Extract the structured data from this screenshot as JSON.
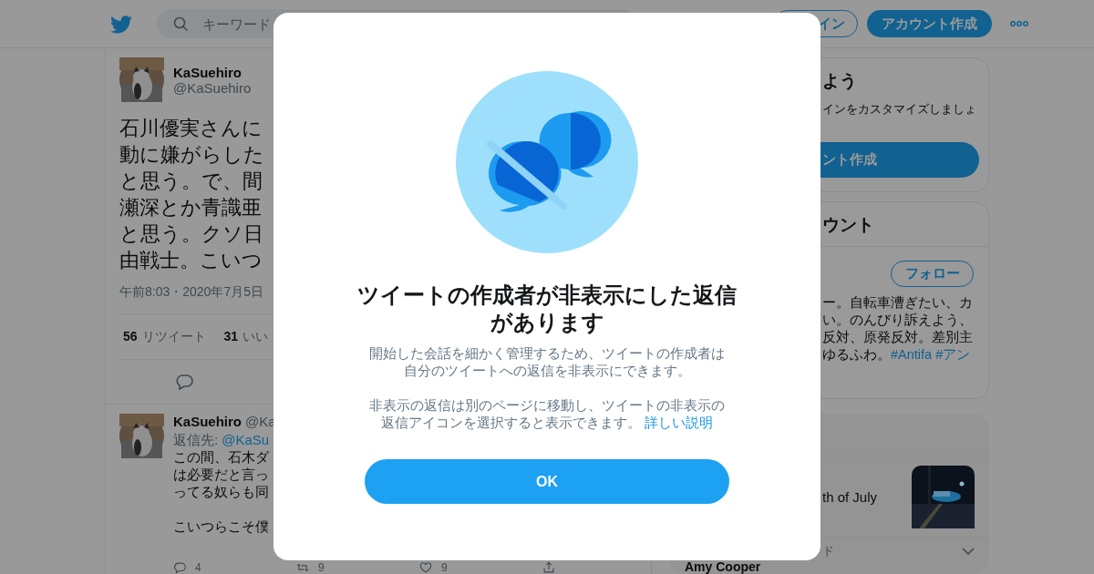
{
  "top_bar": {
    "search": {
      "placeholder": "キーワード"
    },
    "login_button": "イン",
    "signup_button": "アカウント作成"
  },
  "main_tweet": {
    "display_name": "KaSuehiro",
    "handle": "@KaSuehiro",
    "text_lines": [
      "石川優実さんに",
      "動に嫌がらした",
      "と思う。で、間",
      "瀬深とか青識亜",
      "と思う。クソ日",
      "由戦士。こいつ"
    ],
    "timestamp": "午前8:03・2020年7月5日",
    "stats": [
      {
        "count": "56",
        "label": "リツイート"
      },
      {
        "count": "31",
        "label": "いい"
      }
    ]
  },
  "reply": {
    "display_name": "KaSuehiro",
    "handle": "@Ka",
    "reply_to_label": "返信先:",
    "reply_to": "@KaSu",
    "paragraphs": [
      [
        "この間、石木ダ",
        "は必要だと言っ",
        "ってる奴らも同"
      ],
      [
        "こいつらこそ僕"
      ]
    ],
    "actions": [
      {
        "kind": "reply",
        "count": "4"
      },
      {
        "kind": "retweet",
        "count": "9"
      },
      {
        "kind": "like",
        "count": "9"
      },
      {
        "kind": "share"
      }
    ]
  },
  "sidebar": {
    "signup_card": {
      "title": "よう",
      "description": "インをカスタマイズしましょ",
      "button": "ント作成"
    },
    "follow_card": {
      "title": "ウント",
      "follow_button": "フォロー",
      "bio_lines": [
        "ー。自転車漕ぎたい、カ",
        "い。のんびり訴えよう、",
        "反対、原発反対。差別主",
        "ゆるふわ。"
      ],
      "hashtags": [
        "#Antifa",
        "#アン"
      ]
    },
    "trends_card": {
      "items": [
        {
          "kind": "event",
          "title": "th of July"
        },
        {
          "kind": "trend",
          "context": "ド",
          "title": "Amy Cooper"
        }
      ]
    }
  },
  "dialog": {
    "title": "ツイートの作成者が非表示にした返信があります",
    "paragraphs": [
      "開始した会話を細かく管理するため、ツイートの作成者は自分のツイートへの返信を非表示にできます。",
      "非表示の返信は別のページに移動し、ツイートの非表示の返信アイコンを選択すると表示できます。"
    ],
    "link": "詳しい説明",
    "button": "OK"
  }
}
